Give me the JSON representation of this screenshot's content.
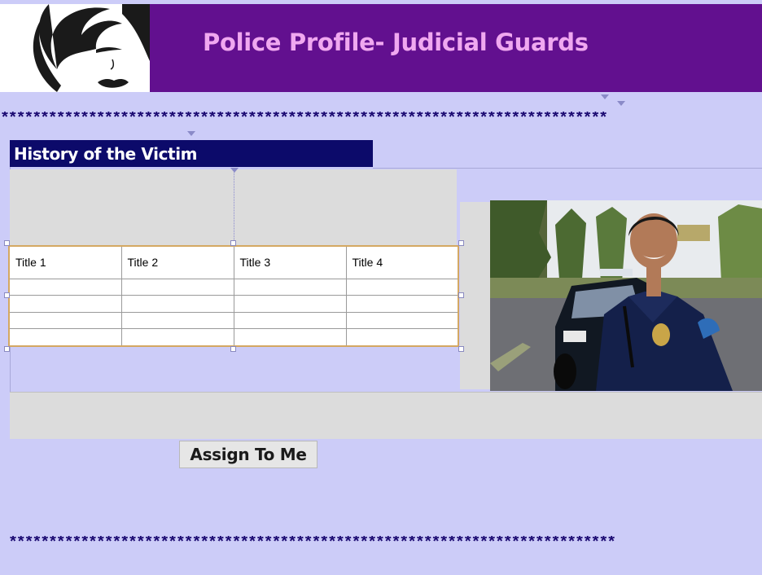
{
  "header": {
    "title": "Police Profile- Judicial Guards",
    "bg_color": "#62108f",
    "title_color": "#f0a8f0",
    "logo_icon": "woman-face-logo-icon"
  },
  "decor": {
    "stars_top": "****************************************************************************",
    "stars_bottom": "****************************************************************************"
  },
  "section": {
    "heading": "History of the Victim",
    "heading_bg": "#0c0a6a"
  },
  "table": {
    "headers": [
      "Title 1",
      "Title 2",
      "Title 3",
      "Title 4"
    ],
    "rows": [
      [
        "",
        "",
        "",
        ""
      ],
      [
        "",
        "",
        "",
        ""
      ],
      [
        "",
        "",
        "",
        ""
      ],
      [
        "",
        "",
        "",
        ""
      ]
    ]
  },
  "photo": {
    "subject": "police-officer-photo"
  },
  "actions": {
    "assign_label": "Assign To Me"
  }
}
